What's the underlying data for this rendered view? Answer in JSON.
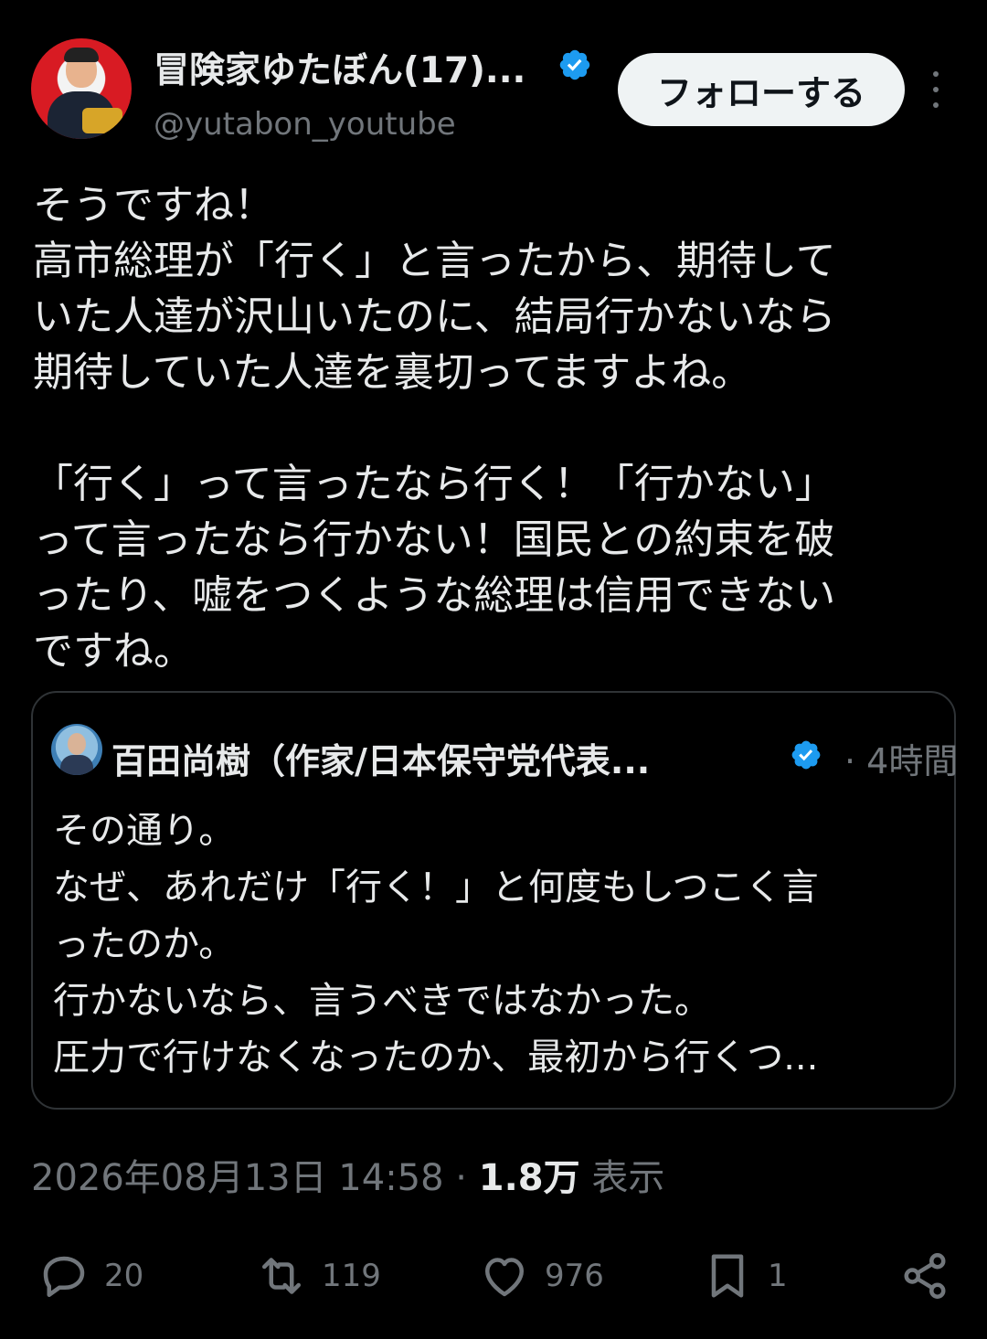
{
  "author": {
    "display_name": "冒険家ゆたぼん(17)...",
    "handle": "@yutabon_youtube",
    "verified": true
  },
  "follow_button_label": "フォローする",
  "tweet_text": "そうですね！\n高市総理が「行く」と言ったから、期待して\nいた人達が沢山いたのに、結局行かないなら\n期待していた人達を裏切ってますよね。\n\n「行く」って言ったなら行く！「行かない」\nって言ったなら行かない！国民との約束を破\nったり、嘘をつくような総理は信用できない\nですね。",
  "quote": {
    "display_name": "百田尚樹（作家/日本保守党代表...",
    "verified": true,
    "time": "· 4時間",
    "text": "その通り。\nなぜ、あれだけ「行く！」と何度もしつこく言\nったのか。\n行かないなら、言うべきではなかった。\n圧力で行けなくなったのか、最初から行くつ..."
  },
  "meta": {
    "timestamp": "2026年08月13日 14:58",
    "separator": " · ",
    "views_count": "1.8万",
    "views_label": " 表示"
  },
  "actions": {
    "reply_count": "20",
    "retweet_count": "119",
    "like_count": "976",
    "bookmark_count": "1"
  },
  "colors": {
    "background": "#000000",
    "text": "#e7e9ea",
    "secondary": "#71767b",
    "verified": "#1d9bf0",
    "follow_bg": "#eff3f4"
  },
  "icons": [
    "more-vertical-icon",
    "verified-badge-icon",
    "reply-icon",
    "retweet-icon",
    "like-icon",
    "bookmark-icon",
    "share-icon"
  ]
}
